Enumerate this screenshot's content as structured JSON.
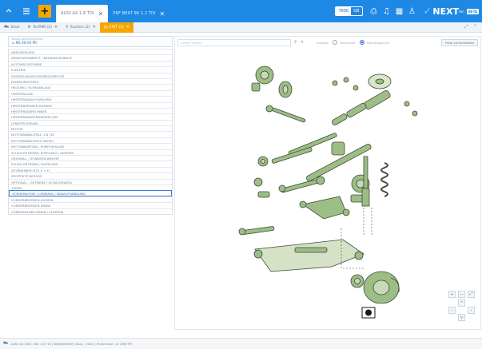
{
  "topbar": {
    "tabs": [
      {
        "label": "AUDI A4 1.8 TDI",
        "active": true
      },
      {
        "label": "PRF BEAT 9K 1.2 TDI",
        "active": false
      }
    ],
    "toggle": {
      "left": "7600",
      "right": "GB"
    },
    "brand": "NEXT",
    "brand_sup": "ten",
    "brand_badge": "BETA",
    "accent": "#1e88e5",
    "plus_color": "#f7a600"
  },
  "subbar": {
    "tabs": [
      {
        "label": "Start",
        "active": false
      },
      {
        "label": "TecRMI",
        "suffix": "(2)",
        "active": false
      },
      {
        "label": "Suchen",
        "suffix": "(2)",
        "active": false
      },
      {
        "label": "ERIT",
        "suffix": "(2)",
        "active": true
      }
    ]
  },
  "left": {
    "crumb_small": "Baugruppenübersicht",
    "crumb_main": "ML 40-05 PR",
    "items": [
      "ANDOVERLAGE",
      "ARMATURENBRETT / BEDIENELEMENTE",
      "AUTOMATGETRIEBE",
      "ELEKTRIK",
      "FAHRZEUGKAROSSERIE/ZUBEHÖR",
      "FEDERUNGSTEILE",
      "HEIZUNG / KLIMAANLAGE",
      "HINTERACHSE",
      "HINTERRADAUFHÄNGUNG",
      "HINTERBREMSEN AUSSEN",
      "HINTERRADERN INNEN",
      "HINTERRADANTRIEBSWELLEN",
      "LENKSTEUERUNG",
      "MOTOR",
      "MOTORANBAUTEILE 1.8 TDI",
      "MOTORANBAUTEILE DIESEL",
      "MOTORWARTUNG, PUMPGEHÄUSE",
      "SCHALTGETRIEBE/ KUPPLUNG / ANTRIEB",
      "ORIGINAL- / SONDERZUBEHÖR",
      "SCHALTGETRIEBE / KUPPLUNG",
      "SITZRAHMEN SITZ E + H",
      "SPORTSITZ-BEZÜGE",
      "OPTIONAL - GETRIEBE / SCHALTUNGEN",
      "TÜREN",
      "VORDERACHSE / LENKUNG / RADAUFHÄNGUNG",
      "VORDERBREMSEN AUSSEN",
      "VORDERBREMSEN INNEN",
      "VORDERRADER INNEN / ELEKTRIK"
    ],
    "selected_index": 24
  },
  "main": {
    "search_placeholder": "Artikel suchen",
    "radio_label_1": "Anzeige",
    "radio_opt_1": "Teilesuche",
    "radio_opt_2": "Fahrzeugsuche",
    "reset_label": "Filter zurücksetzen",
    "part_color": "#8fb27a"
  },
  "status": {
    "text": "AUDI A4 (8E2, B6) 1.8 TDI | 88kW/90kW | Bauj.: 2002 | Motorcode: 12 AMB PR"
  }
}
